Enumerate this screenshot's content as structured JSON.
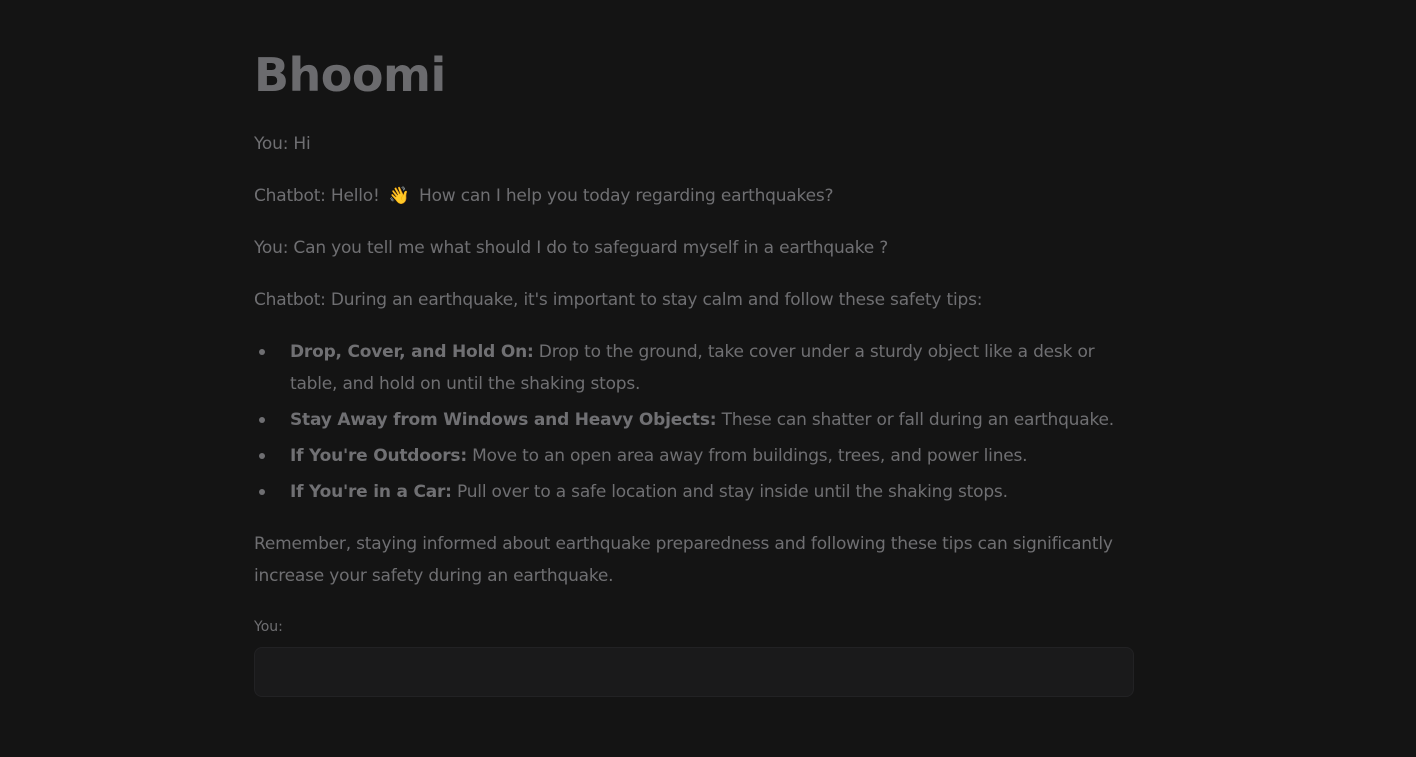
{
  "app": {
    "title": "Bhoomi"
  },
  "conversation": [
    {
      "speaker": "You",
      "text": "You: Hi"
    },
    {
      "speaker": "Chatbot",
      "text_before": "Chatbot: Hello! ",
      "emoji": "👋",
      "text_after": " How can I help you today regarding earthquakes?"
    },
    {
      "speaker": "You",
      "text": "You: Can you tell me what should I do to safeguard myself in a earthquake ?"
    },
    {
      "speaker": "Chatbot",
      "text": "Chatbot: During an earthquake, it's important to stay calm and follow these safety tips:"
    }
  ],
  "tips": [
    {
      "title": "Drop, Cover, and Hold On:",
      "text": " Drop to the ground, take cover under a sturdy object like a desk or table, and hold on until the shaking stops."
    },
    {
      "title": "Stay Away from Windows and Heavy Objects:",
      "text": " These can shatter or fall during an earthquake."
    },
    {
      "title": "If You're Outdoors:",
      "text": " Move to an open area away from buildings, trees, and power lines."
    },
    {
      "title": "If You're in a Car:",
      "text": " Pull over to a safe location and stay inside until the shaking stops."
    }
  ],
  "closing": "Remember, staying informed about earthquake preparedness and following these tips can significantly increase your safety during an earthquake.",
  "input": {
    "label": "You:",
    "value": "",
    "placeholder": ""
  },
  "colors": {
    "background": "#141414",
    "text": "#6f6f72",
    "input_background": "#1a1a1b"
  }
}
